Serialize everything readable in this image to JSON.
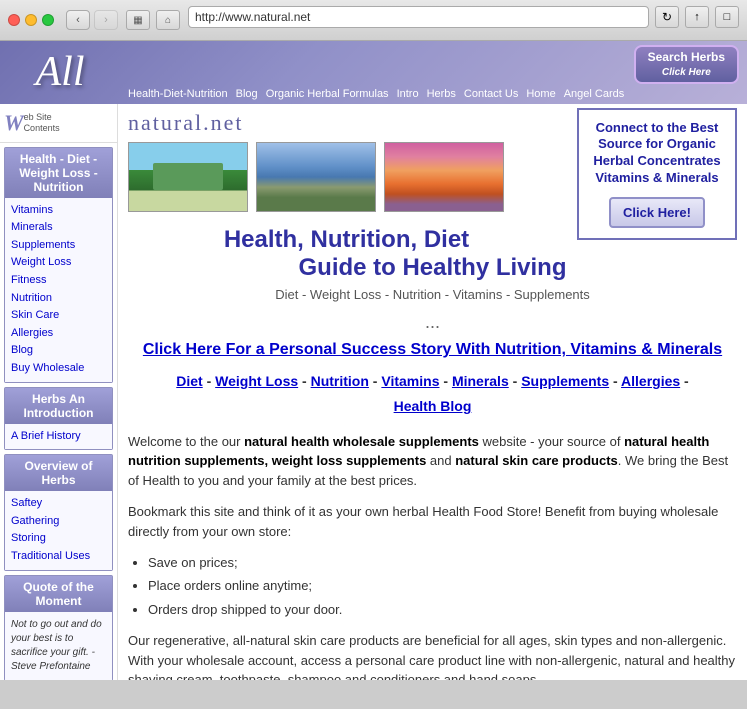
{
  "browser": {
    "address": "http://www.natural.net",
    "back_disabled": false,
    "forward_disabled": true
  },
  "site": {
    "logo": "All",
    "domain": "natural.net",
    "search_btn": "Search Herbs",
    "search_click": "Click Here",
    "top_nav": [
      "Health-Diet-Nutrition",
      "Blog",
      "Organic Herbal Formulas",
      "Intro",
      "Herbs",
      "Contact Us",
      "Home",
      "Angel Cards"
    ]
  },
  "sidebar": {
    "logo_w": "W",
    "logo_line1": "eb Site",
    "logo_line2": "Contents",
    "section1_header": "Health - Diet - Weight Loss - Nutrition",
    "section1_links": [
      "Vitamins",
      "Minerals",
      "Supplements",
      "Weight Loss",
      "Fitness",
      "Nutrition",
      "Skin Care",
      "Allergies",
      "Blog",
      "Buy Wholesale"
    ],
    "section2_header": "Herbs An Introduction",
    "section2_links": [
      "A Brief History"
    ],
    "section3_header": "Overview of Herbs",
    "section3_links": [
      "Saftey",
      "Gathering",
      "Storing",
      "Traditional Uses"
    ],
    "quote_header_line1": "Quote of the",
    "quote_header_line2": "Moment",
    "quote_text": "Not to go out and do your best is to sacrifice your gift.",
    "quote_author": "- Steve Prefontaine"
  },
  "content": {
    "domain": "natural.net",
    "main_title_line1": "Health, Nutrition, Diet",
    "main_title_line2": "Guide to Healthy Living",
    "main_subtitle": "Diet - Weight Loss - Nutrition - Vitamins - Supplements",
    "dots": "...",
    "success_story": "Click Here For a Personal Success Story With Nutrition, Vitamins & Minerals",
    "category_links": [
      {
        "label": "Diet",
        "separator": " - "
      },
      {
        "label": "Weight Loss",
        "separator": " - "
      },
      {
        "label": "Nutrition",
        "separator": " - "
      },
      {
        "label": "Vitamins",
        "separator": " - "
      },
      {
        "label": "Minerals",
        "separator": " - "
      },
      {
        "label": "Supplements",
        "separator": " - "
      },
      {
        "label": "Allergies",
        "separator": " - "
      },
      {
        "label": "Health Blog",
        "separator": ""
      }
    ],
    "connect_box": {
      "text": "Connect to the Best Source for Organic Herbal Concentrates Vitamins & Minerals",
      "btn": "Click Here!"
    },
    "body_intro": "Welcome to the our ",
    "body_bold1": "natural health wholesale supplements",
    "body_mid1": " website - your source of ",
    "body_bold2": "natural health nutrition supplements, weight loss supplements",
    "body_mid2": " and ",
    "body_bold3": "natural skin care products",
    "body_mid3": ". We bring the Best of Health to you and your family at the best prices.",
    "body_bookmark": "Bookmark this site and think of it as your own herbal Health Food Store! Benefit from buying wholesale directly from your own store:",
    "bullets": [
      "Save on prices;",
      "Place orders online anytime;",
      "Orders drop shipped to your door."
    ],
    "body_skin": "Our regenerative, all-natural skin care products are beneficial for all ages, skin types and non-allergenic. With your wholesale account, access a personal care product line with non-allergenic, natural and healthy shaving cream, toothpaste, shampoo and conditioners and hand soaps."
  }
}
